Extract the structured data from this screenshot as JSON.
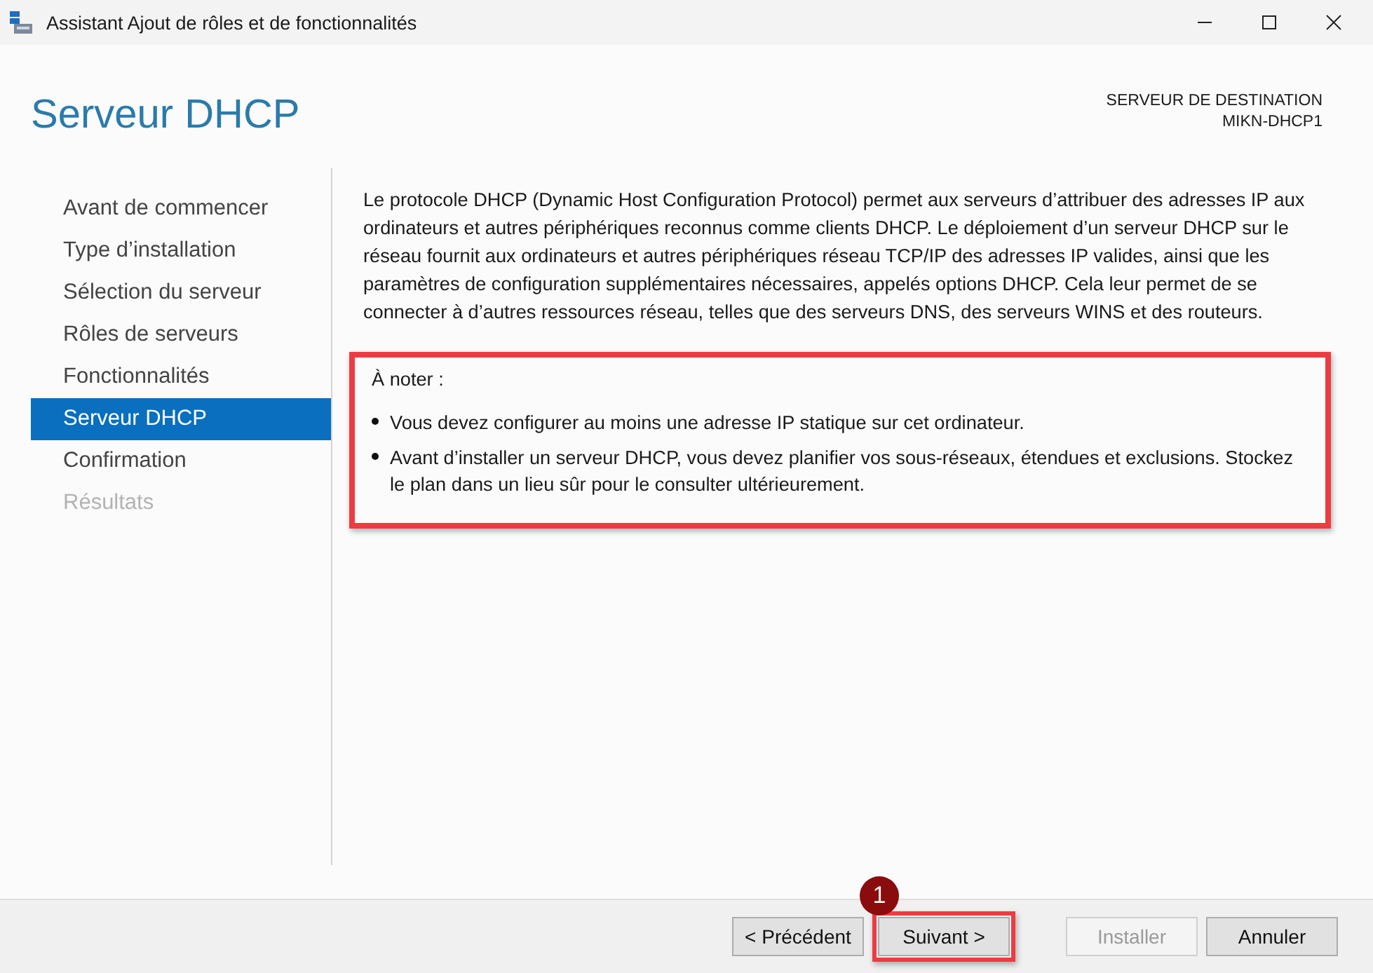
{
  "window": {
    "title": "Assistant Ajout de rôles et de fonctionnalités"
  },
  "page_title": "Serveur DHCP",
  "destination": {
    "label": "SERVEUR DE DESTINATION",
    "server": "MIKN-DHCP1"
  },
  "nav": [
    {
      "label": "Avant de commencer",
      "selected": false,
      "disabled": false
    },
    {
      "label": "Type d’installation",
      "selected": false,
      "disabled": false
    },
    {
      "label": "Sélection du serveur",
      "selected": false,
      "disabled": false
    },
    {
      "label": "Rôles de serveurs",
      "selected": false,
      "disabled": false
    },
    {
      "label": "Fonctionnalités",
      "selected": false,
      "disabled": false
    },
    {
      "label": "Serveur DHCP",
      "selected": true,
      "disabled": false
    },
    {
      "label": "Confirmation",
      "selected": false,
      "disabled": false
    },
    {
      "label": "Résultats",
      "selected": false,
      "disabled": true
    }
  ],
  "description": "Le protocole DHCP (Dynamic Host Configuration Protocol) permet aux serveurs d’attribuer des adresses IP aux ordinateurs et autres périphériques reconnus comme clients DHCP. Le déploiement d’un serveur DHCP sur le réseau fournit aux ordinateurs et autres périphériques réseau TCP/IP des adresses IP valides, ainsi que les paramètres de configuration supplémentaires nécessaires, appelés options DHCP. Cela leur permet de se connecter à d’autres ressources réseau, telles que des serveurs DNS, des serveurs WINS et des routeurs.",
  "note": {
    "heading": "À noter :",
    "highlighted": true,
    "bullets": [
      "Vous devez configurer au moins une adresse IP statique sur cet ordinateur.",
      "Avant d’installer un serveur DHCP, vous devez planifier vos sous-réseaux, étendues et exclusions. Stockez le plan dans un lieu sûr pour le consulter ultérieurement."
    ]
  },
  "buttons": [
    {
      "label": "< Précédent",
      "disabled": false,
      "highlighted": false
    },
    {
      "label": "Suivant >",
      "disabled": false,
      "highlighted": true,
      "step": "1"
    },
    {
      "label": "Installer",
      "disabled": true,
      "highlighted": false
    },
    {
      "label": "Annuler",
      "disabled": false,
      "highlighted": false
    }
  ]
}
